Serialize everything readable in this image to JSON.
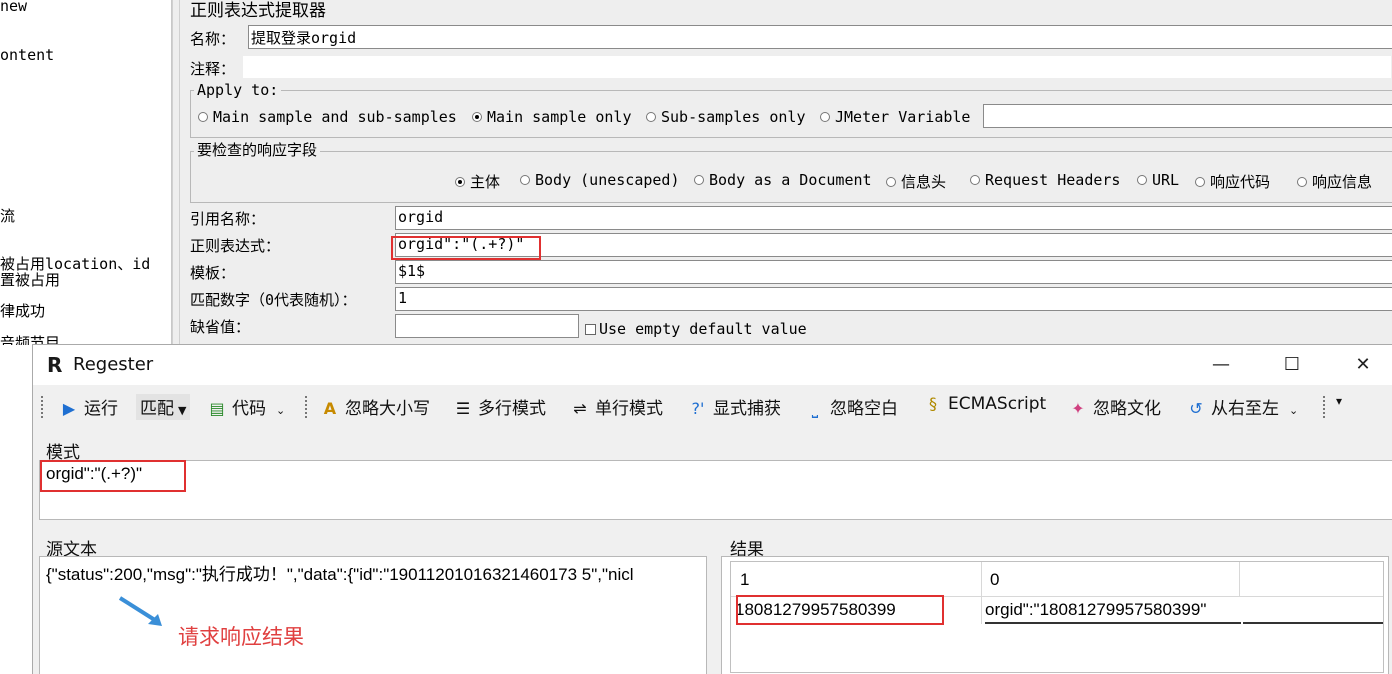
{
  "left_tree": {
    "items": [
      "new",
      "ontent",
      "流",
      "被占用location、id",
      "置被占用",
      "律成功",
      "音频节目"
    ]
  },
  "extractor": {
    "title": "正则表达式提取器",
    "name_label": "名称：",
    "name_value": "提取登录orgid",
    "comment_label": "注释：",
    "apply_to": {
      "legend": "Apply to:",
      "options": [
        "Main sample and sub-samples",
        "Main sample only",
        "Sub-samples only",
        "JMeter Variable"
      ],
      "selected_index": 1
    },
    "field_check": {
      "legend": "要检查的响应字段",
      "options": [
        "主体",
        "Body (unescaped)",
        "Body as a Document",
        "信息头",
        "Request Headers",
        "URL",
        "响应代码",
        "响应信息"
      ],
      "selected_index": 0
    },
    "ref_name_label": "引用名称：",
    "ref_name_value": "orgid",
    "regex_label": "正则表达式：",
    "regex_value": "orgid\":\"(.+?)\"",
    "template_label": "模板：",
    "template_value": "$1$",
    "match_no_label": "匹配数字（0代表随机）：",
    "match_no_value": "1",
    "default_label": "缺省值：",
    "default_value": "",
    "use_empty_label": "Use empty default value"
  },
  "regester": {
    "title": "Regester",
    "logo": "R",
    "toolbar": {
      "run": "运行",
      "match_mode": "匹配",
      "code": "代码",
      "ignore_case": "忽略大小写",
      "multiline": "多行模式",
      "singleline": "单行模式",
      "explicit_capture": "显式捕获",
      "ignore_whitespace": "忽略空白",
      "ecmascript": "ECMAScript",
      "ignore_culture": "忽略文化",
      "right_to_left": "从右至左"
    },
    "pattern_title": "模式",
    "pattern_value": "orgid\":\"(.+?)\"",
    "source_title": "源文本",
    "source_value": "{\"status\":200,\"msg\":\"执行成功！\",\"data\":{\"id\":\"19011201016321460173 5\",\"nicl",
    "annotation": "请求响应结果",
    "result_title": "结果",
    "result_columns": [
      "1",
      "0"
    ],
    "result_rows": [
      [
        "18081279957580399",
        "orgid\":\"18081279957580399\""
      ]
    ]
  },
  "colors": {
    "highlight_box": "#e03030",
    "annotation_text": "#e04040",
    "annotation_arrow": "#3a8fd8",
    "run_icon": "#1f6fd1"
  }
}
